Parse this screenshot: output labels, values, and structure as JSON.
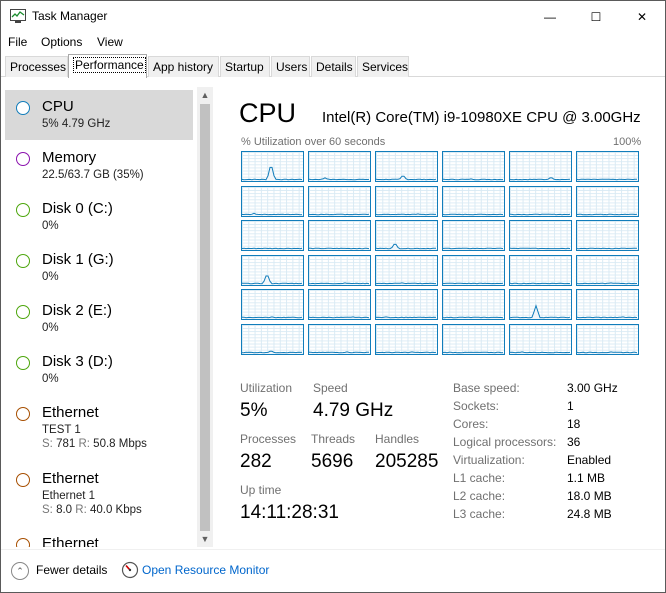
{
  "window": {
    "title": "Task Manager",
    "minimize_glyph": "—",
    "maximize_glyph": "☐",
    "close_glyph": "✕"
  },
  "menu": [
    "File",
    "Options",
    "View"
  ],
  "tabs": [
    {
      "label": "Processes",
      "active": false
    },
    {
      "label": "Performance",
      "active": true
    },
    {
      "label": "App history",
      "active": false
    },
    {
      "label": "Startup",
      "active": false
    },
    {
      "label": "Users",
      "active": false
    },
    {
      "label": "Details",
      "active": false
    },
    {
      "label": "Services",
      "active": false
    }
  ],
  "colors": {
    "cpu": "#117dbb",
    "memory": "#8b12ae",
    "disk": "#4da60c",
    "ethernet": "#a74f01",
    "grid": "#d9eaf4",
    "link": "#0066cc"
  },
  "resources": [
    {
      "name": "CPU",
      "sub": "5%  4.79 GHz",
      "color": "cpu",
      "selected": true
    },
    {
      "name": "Memory",
      "sub": "22.5/63.7 GB (35%)",
      "color": "memory"
    },
    {
      "name": "Disk 0 (C:)",
      "sub": "0%",
      "color": "disk"
    },
    {
      "name": "Disk 1 (G:)",
      "sub": "0%",
      "color": "disk"
    },
    {
      "name": "Disk 2 (E:)",
      "sub": "0%",
      "color": "disk"
    },
    {
      "name": "Disk 3 (D:)",
      "sub": "0%",
      "color": "disk"
    },
    {
      "name": "Ethernet",
      "sub": "TEST 1",
      "s_label": "S:",
      "s_value": "781",
      "r_label": "R:",
      "r_value": "50.8 Mbps",
      "color": "ethernet"
    },
    {
      "name": "Ethernet",
      "sub": "Ethernet 1",
      "s_label": "S:",
      "s_value": "8.0",
      "r_label": "R:",
      "r_value": "40.0 Kbps",
      "color": "ethernet"
    },
    {
      "name": "Ethernet",
      "sub": "",
      "color": "ethernet"
    }
  ],
  "scrollbar": {
    "up_glyph": "▲",
    "down_glyph": "▼"
  },
  "cpu": {
    "title": "CPU",
    "model": "Intel(R) Core(TM) i9-10980XE CPU @ 3.00GHz",
    "graph_caption": "% Utilization over 60 seconds",
    "graph_max": "100%",
    "core_usage_pct": [
      60,
      8,
      18,
      4,
      10,
      4,
      6,
      4,
      4,
      2,
      4,
      4,
      2,
      2,
      22,
      4,
      4,
      2,
      38,
      4,
      4,
      4,
      2,
      4,
      4,
      4,
      4,
      2,
      44,
      4,
      8,
      4,
      4,
      2,
      4,
      4
    ]
  },
  "stats": {
    "utilization_label": "Utilization",
    "utilization": "5%",
    "speed_label": "Speed",
    "speed": "4.79 GHz",
    "processes_label": "Processes",
    "processes": "282",
    "threads_label": "Threads",
    "threads": "5696",
    "handles_label": "Handles",
    "handles": "205285",
    "uptime_label": "Up time",
    "uptime": "14:11:28:31"
  },
  "details": [
    {
      "label": "Base speed:",
      "value": "3.00 GHz"
    },
    {
      "label": "Sockets:",
      "value": "1"
    },
    {
      "label": "Cores:",
      "value": "18"
    },
    {
      "label": "Logical processors:",
      "value": "36"
    },
    {
      "label": "Virtualization:",
      "value": "Enabled"
    },
    {
      "label": "L1 cache:",
      "value": "1.1 MB"
    },
    {
      "label": "L2 cache:",
      "value": "18.0 MB"
    },
    {
      "label": "L3 cache:",
      "value": "24.8 MB"
    }
  ],
  "footer": {
    "fewer_details": "Fewer details",
    "open_resource_monitor": "Open Resource Monitor"
  }
}
